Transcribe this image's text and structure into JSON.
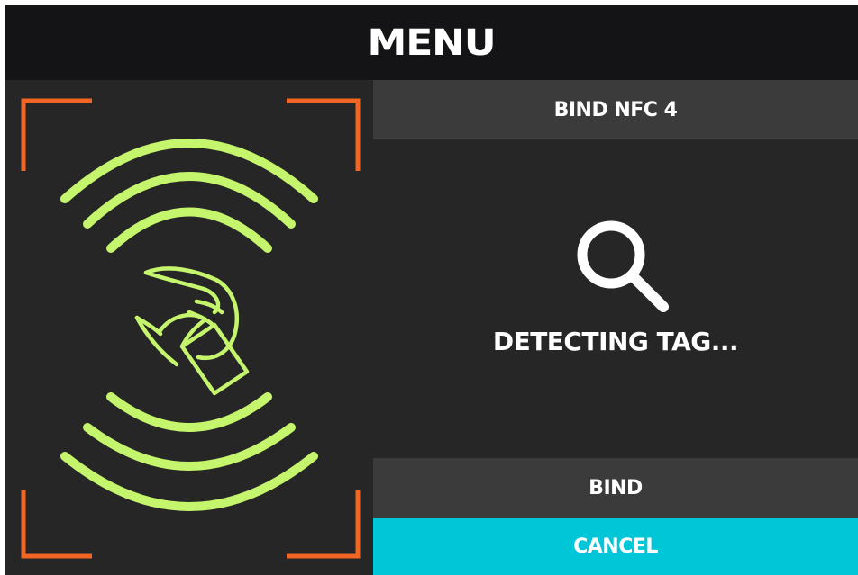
{
  "header": {
    "title": "MENU"
  },
  "nfc_panel": {
    "icon": "nfc-tap-icon",
    "accent_color": "#c5f56c",
    "frame_color": "#f26522"
  },
  "bind_panel": {
    "heading": "BIND NFC 4",
    "status_icon": "search-icon",
    "status_text": "DETECTING TAG...",
    "bind_label": "BIND",
    "cancel_label": "CANCEL",
    "cancel_color": "#00c6d7"
  }
}
